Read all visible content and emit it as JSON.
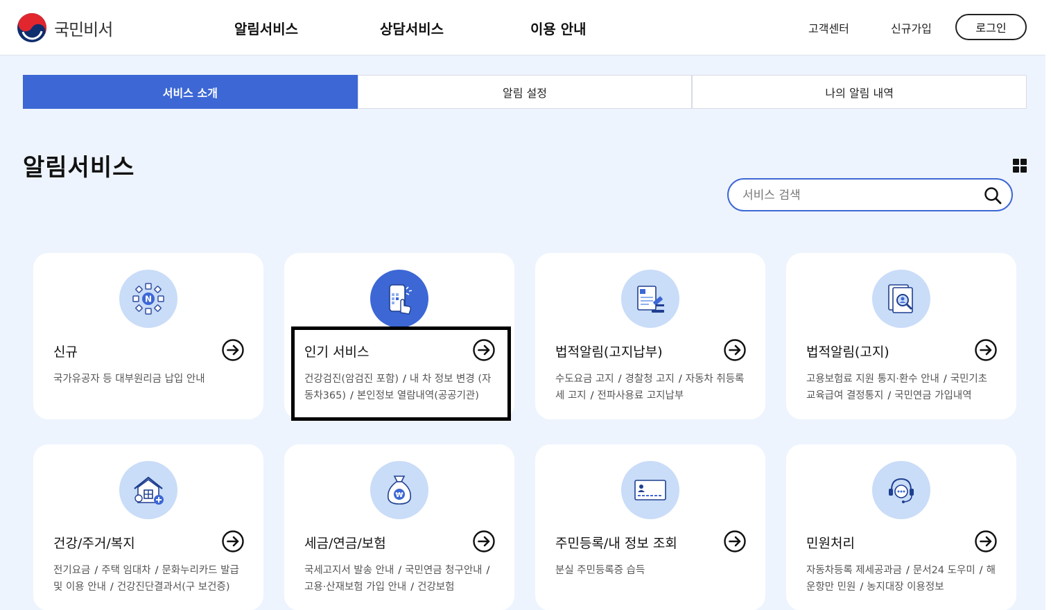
{
  "header": {
    "logo_text": "국민비서",
    "nav": [
      {
        "label": "알림서비스"
      },
      {
        "label": "상담서비스"
      },
      {
        "label": "이용 안내"
      }
    ],
    "util": [
      {
        "label": "고객센터"
      },
      {
        "label": "신규가입"
      }
    ],
    "login_label": "로그인"
  },
  "tabs": [
    {
      "label": "서비스 소개",
      "active": true
    },
    {
      "label": "알림 설정",
      "active": false
    },
    {
      "label": "나의 알림 내역",
      "active": false
    }
  ],
  "page": {
    "title": "알림서비스",
    "search_placeholder": "서비스 검색"
  },
  "cards": [
    {
      "title": "신규",
      "icon": "new-network-icon",
      "items": [
        "국가유공자 등 대부원리금 납입 안내"
      ]
    },
    {
      "title": "인기 서비스",
      "icon": "phone-touch-icon",
      "items": [
        "건강검진(암검진 포함)",
        "내 차 정보 변경 (자동차365)",
        "본인정보 열람내역(공공기관)"
      ]
    },
    {
      "title": "법적알림(고지납부)",
      "icon": "document-gavel-icon",
      "items": [
        "수도요금 고지",
        "경찰청 고지",
        "자동차 취등록세 고지",
        "전파사용료 고지납부"
      ]
    },
    {
      "title": "법적알림(고지)",
      "icon": "document-search-icon",
      "items": [
        "고용보험료 지원 통지·환수 안내",
        "국민기초 교육급여 결정통지",
        "국민연금 가입내역"
      ]
    },
    {
      "title": "건강/주거/복지",
      "icon": "house-health-icon",
      "items": [
        "전기요금",
        "주택 임대차",
        "문화누리카드 발급 및 이용 안내",
        "건강진단결과서(구 보건증)"
      ]
    },
    {
      "title": "세금/연금/보험",
      "icon": "money-bag-icon",
      "items": [
        "국세고지서 발송 안내",
        "국민연금 청구안내",
        "고용·산재보험 가입 안내",
        "건강보험"
      ]
    },
    {
      "title": "주민등록/내 정보 조회",
      "icon": "id-card-icon",
      "items": [
        "분실 주민등록증 습득"
      ]
    },
    {
      "title": "민원처리",
      "icon": "headset-icon",
      "items": [
        "자동차등록 제세공과금",
        "문서24 도우미",
        "해운항만 민원",
        "농지대장 이용정보"
      ]
    }
  ],
  "colors": {
    "accent": "#3c67d5",
    "icon_bg": "#c9dcf8",
    "page_bg": "#eef4fd"
  }
}
